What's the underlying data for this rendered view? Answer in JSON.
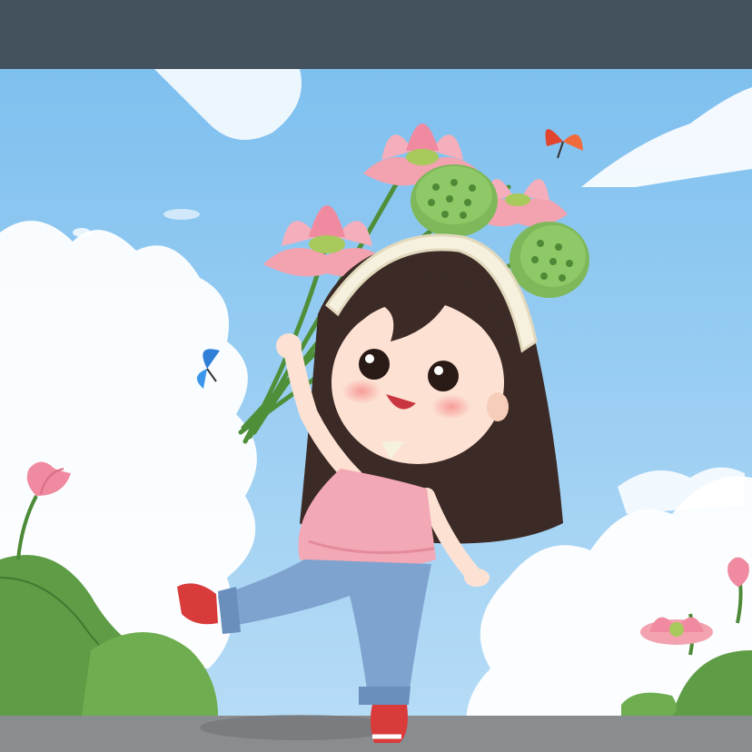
{
  "viewer": {
    "top_bar_color": "#44525e"
  },
  "illustration": {
    "subject": "illustration",
    "palette": {
      "sky_top": "#7ec0ef",
      "sky_bottom": "#b9ddf6",
      "cloud": "#ffffff",
      "petal": "#f3a2b0",
      "petal_dark": "#e57f93",
      "pod": "#7fb85a",
      "leaf": "#5e9c45",
      "top": "#f2a8b5",
      "jeans": "#7fa3cf",
      "hair": "#3b2a25",
      "skin": "#fde2d4",
      "shoe": "#d93a3a",
      "ground": "#8a8d90"
    }
  }
}
